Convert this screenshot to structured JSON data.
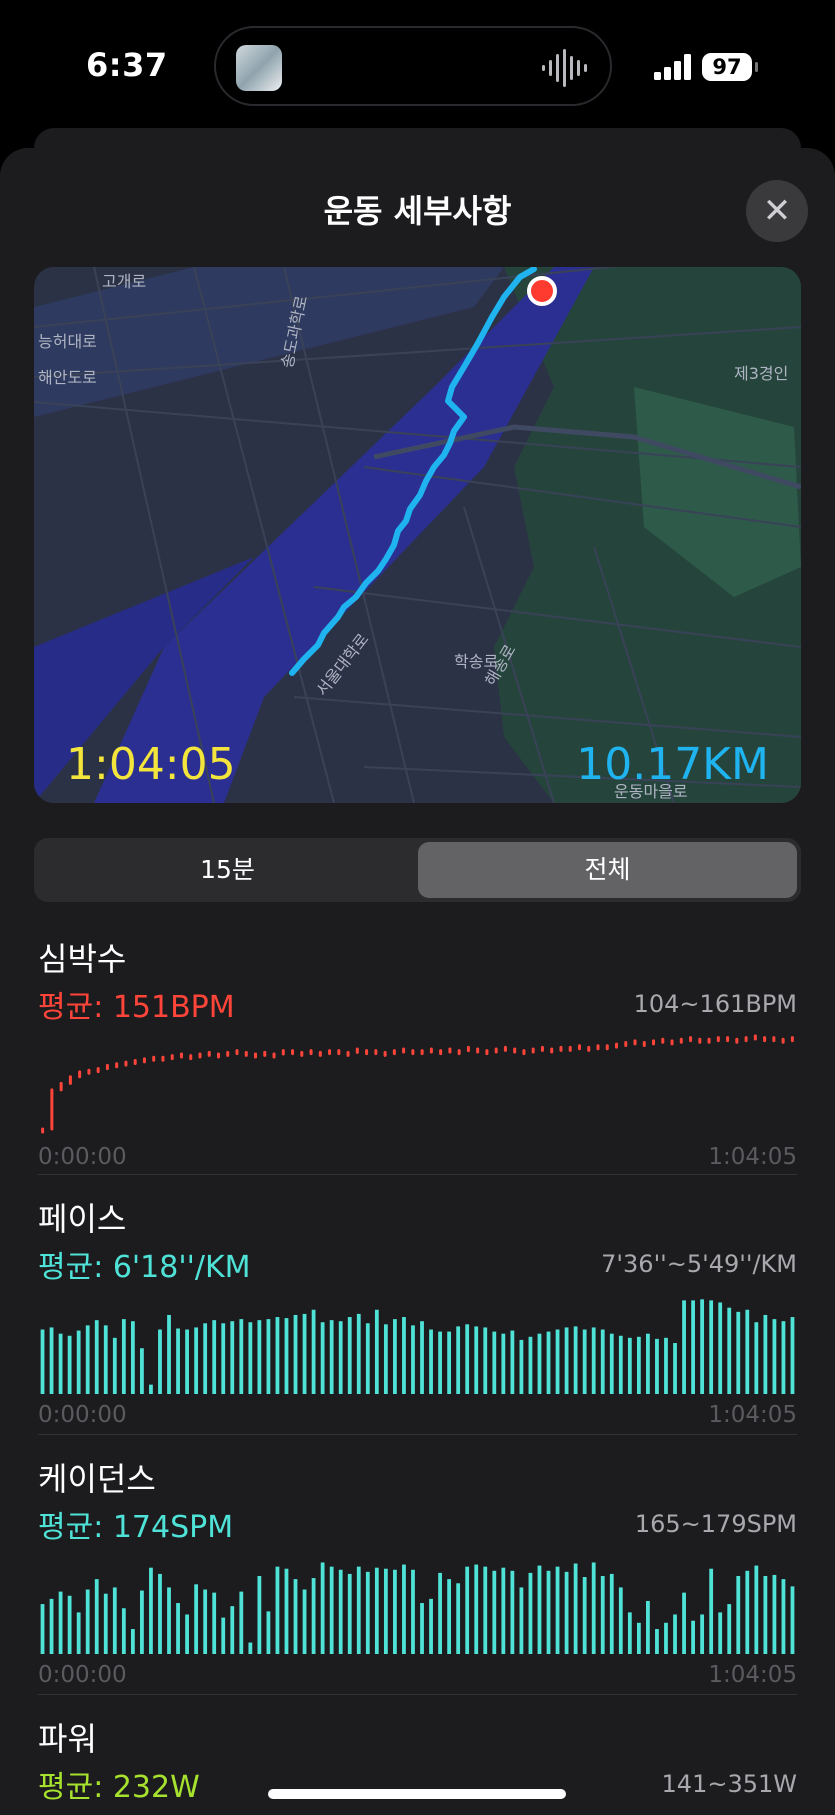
{
  "status": {
    "time": "6:37",
    "battery": "97"
  },
  "sheet": {
    "title": "운동 세부사항",
    "close_icon": "xmark-icon"
  },
  "map": {
    "duration": "1:04:05",
    "distance": "10.17KM",
    "labels": [
      "고개로",
      "능허대로",
      "해안도로",
      "송도과학로",
      "제3경인",
      "해송로",
      "서울대학로",
      "학송로",
      "운동마을로"
    ],
    "colors": {
      "route": "#1fb4f0",
      "end_marker": "#ff3b30",
      "duration": "#f4e53d"
    }
  },
  "segment": {
    "options": [
      "15분",
      "전체"
    ],
    "selected": "전체"
  },
  "metrics": {
    "heart": {
      "title": "심박수",
      "average": "평균: 151BPM",
      "range": "104~161BPM",
      "start": "0:00:00",
      "end": "1:04:05",
      "color": "#ff453a"
    },
    "pace": {
      "title": "페이스",
      "average": "평균: 6'18''/KM",
      "range": "7'36''~5'49''/KM",
      "start": "0:00:00",
      "end": "1:04:05",
      "color": "#4fe3d8"
    },
    "cadence": {
      "title": "케이던스",
      "average": "평균: 174SPM",
      "range": "165~179SPM",
      "start": "0:00:00",
      "end": "1:04:05",
      "color": "#4fe3d8"
    },
    "power": {
      "title": "파워",
      "average": "평균: 232W",
      "range": "141~351W",
      "color": "#a6e22e"
    }
  },
  "chart_data": [
    {
      "type": "line",
      "title": "심박수",
      "unit": "BPM",
      "ylim": [
        104,
        161
      ],
      "x_range": [
        "0:00:00",
        "1:04:05"
      ],
      "values": [
        104,
        128,
        132,
        136,
        139,
        140,
        141,
        143,
        144,
        145,
        146,
        147,
        148,
        148,
        149,
        150,
        149,
        150,
        151,
        150,
        151,
        152,
        151,
        150,
        151,
        150,
        152,
        152,
        151,
        152,
        151,
        152,
        152,
        151,
        153,
        152,
        152,
        151,
        152,
        153,
        152,
        152,
        153,
        152,
        153,
        152,
        154,
        153,
        152,
        153,
        154,
        153,
        152,
        153,
        154,
        153,
        154,
        154,
        155,
        154,
        155,
        155,
        156,
        157,
        158,
        157,
        158,
        159,
        158,
        159,
        160,
        159,
        159,
        160,
        160,
        159,
        160,
        161,
        160,
        160,
        159,
        160
      ]
    },
    {
      "type": "bar",
      "title": "페이스",
      "unit": "/KM",
      "ylim": [
        "7'36''",
        "5'49''"
      ],
      "x_range": [
        "0:00:00",
        "1:04:05"
      ],
      "values": [
        0.62,
        0.64,
        0.58,
        0.56,
        0.61,
        0.66,
        0.71,
        0.66,
        0.54,
        0.72,
        0.7,
        0.44,
        0.09,
        0.62,
        0.76,
        0.63,
        0.62,
        0.64,
        0.68,
        0.71,
        0.68,
        0.7,
        0.72,
        0.69,
        0.71,
        0.72,
        0.74,
        0.73,
        0.76,
        0.77,
        0.81,
        0.69,
        0.71,
        0.7,
        0.74,
        0.77,
        0.68,
        0.81,
        0.67,
        0.72,
        0.74,
        0.66,
        0.7,
        0.62,
        0.6,
        0.6,
        0.65,
        0.67,
        0.65,
        0.64,
        0.6,
        0.58,
        0.61,
        0.52,
        0.55,
        0.58,
        0.6,
        0.62,
        0.64,
        0.65,
        0.62,
        0.64,
        0.62,
        0.58,
        0.56,
        0.54,
        0.55,
        0.58,
        0.53,
        0.54,
        0.49,
        0.9,
        0.9,
        0.91,
        0.9,
        0.88,
        0.83,
        0.79,
        0.81,
        0.69,
        0.76,
        0.72,
        0.7,
        0.74
      ]
    },
    {
      "type": "bar",
      "title": "케이던스",
      "unit": "SPM",
      "ylim": [
        165,
        179
      ],
      "x_range": [
        "0:00:00",
        "1:04:05"
      ],
      "values": [
        0.48,
        0.53,
        0.6,
        0.56,
        0.4,
        0.62,
        0.72,
        0.58,
        0.64,
        0.44,
        0.24,
        0.61,
        0.83,
        0.77,
        0.64,
        0.49,
        0.38,
        0.67,
        0.62,
        0.59,
        0.35,
        0.46,
        0.6,
        0.11,
        0.75,
        0.41,
        0.84,
        0.82,
        0.72,
        0.62,
        0.73,
        0.88,
        0.84,
        0.81,
        0.77,
        0.84,
        0.79,
        0.83,
        0.82,
        0.81,
        0.86,
        0.81,
        0.49,
        0.53,
        0.78,
        0.72,
        0.68,
        0.84,
        0.86,
        0.84,
        0.8,
        0.83,
        0.8,
        0.64,
        0.78,
        0.85,
        0.8,
        0.84,
        0.79,
        0.87,
        0.74,
        0.88,
        0.75,
        0.77,
        0.64,
        0.4,
        0.3,
        0.51,
        0.24,
        0.3,
        0.38,
        0.59,
        0.32,
        0.38,
        0.82,
        0.4,
        0.48,
        0.75,
        0.8,
        0.85,
        0.75,
        0.76,
        0.72,
        0.65
      ]
    },
    {
      "type": "bar",
      "title": "파워",
      "unit": "W",
      "ylim": [
        141,
        351
      ],
      "values": []
    }
  ]
}
